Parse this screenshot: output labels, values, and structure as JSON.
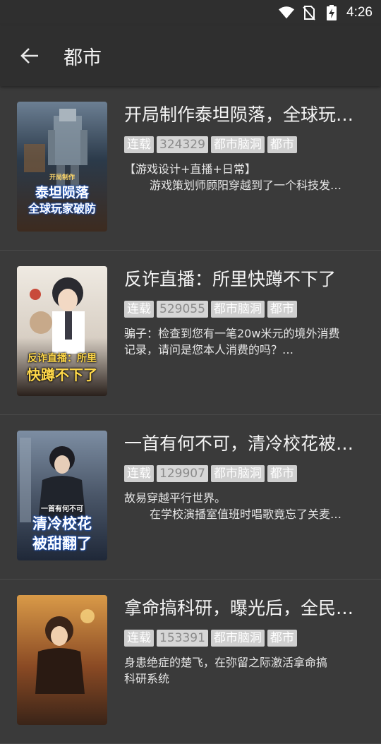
{
  "status_bar": {
    "time": "4:26",
    "icons": [
      "wifi-icon",
      "no-sim-icon",
      "battery-charging-icon"
    ]
  },
  "app_bar": {
    "title": "都市",
    "back_icon": "arrow-left-icon"
  },
  "books": [
    {
      "title": "开局制作泰坦陨落，全球玩…",
      "tags": [
        "连载",
        "324329",
        "都市脑洞",
        "都市"
      ],
      "desc_lines": [
        "【游戏设计+直播+日常】",
        "游戏策划师顾阳穿越到了一个科技发…"
      ],
      "cover_lines": [
        "开局制作",
        "泰坦陨落",
        "全球玩家破防"
      ],
      "cover_colors": [
        "#2b3a4a",
        "#7a5a3a"
      ]
    },
    {
      "title": "反诈直播：所里快蹲不下了",
      "tags": [
        "连载",
        "529055",
        "都市脑洞",
        "都市"
      ],
      "desc_lines": [
        "骗子：检查到您有一笔20w米元的境外消费",
        "记录，请问是您本人消费的吗？…"
      ],
      "cover_lines": [
        "反诈直播：所里",
        "快蹲不下了"
      ],
      "cover_colors": [
        "#e9e4dc",
        "#3a2e28"
      ]
    },
    {
      "title": "一首有何不可，清冷校花被…",
      "tags": [
        "连载",
        "129907",
        "都市脑洞",
        "都市"
      ],
      "desc_lines": [
        "故易穿越平行世界。",
        "在学校演播室值班时唱歌竟忘了关麦…"
      ],
      "cover_lines": [
        "一首有何不可",
        "清冷校花",
        "被甜翻了"
      ],
      "cover_colors": [
        "#5a6b82",
        "#1f2838"
      ]
    },
    {
      "title": "拿命搞科研，曝光后，全民…",
      "tags": [
        "连载",
        "153391",
        "都市脑洞",
        "都市"
      ],
      "desc_lines": [
        "身患绝症的楚飞，在弥留之际激活拿命搞",
        "科研系统"
      ],
      "cover_lines": [],
      "cover_colors": [
        "#c98a3a",
        "#3a2418"
      ]
    }
  ]
}
